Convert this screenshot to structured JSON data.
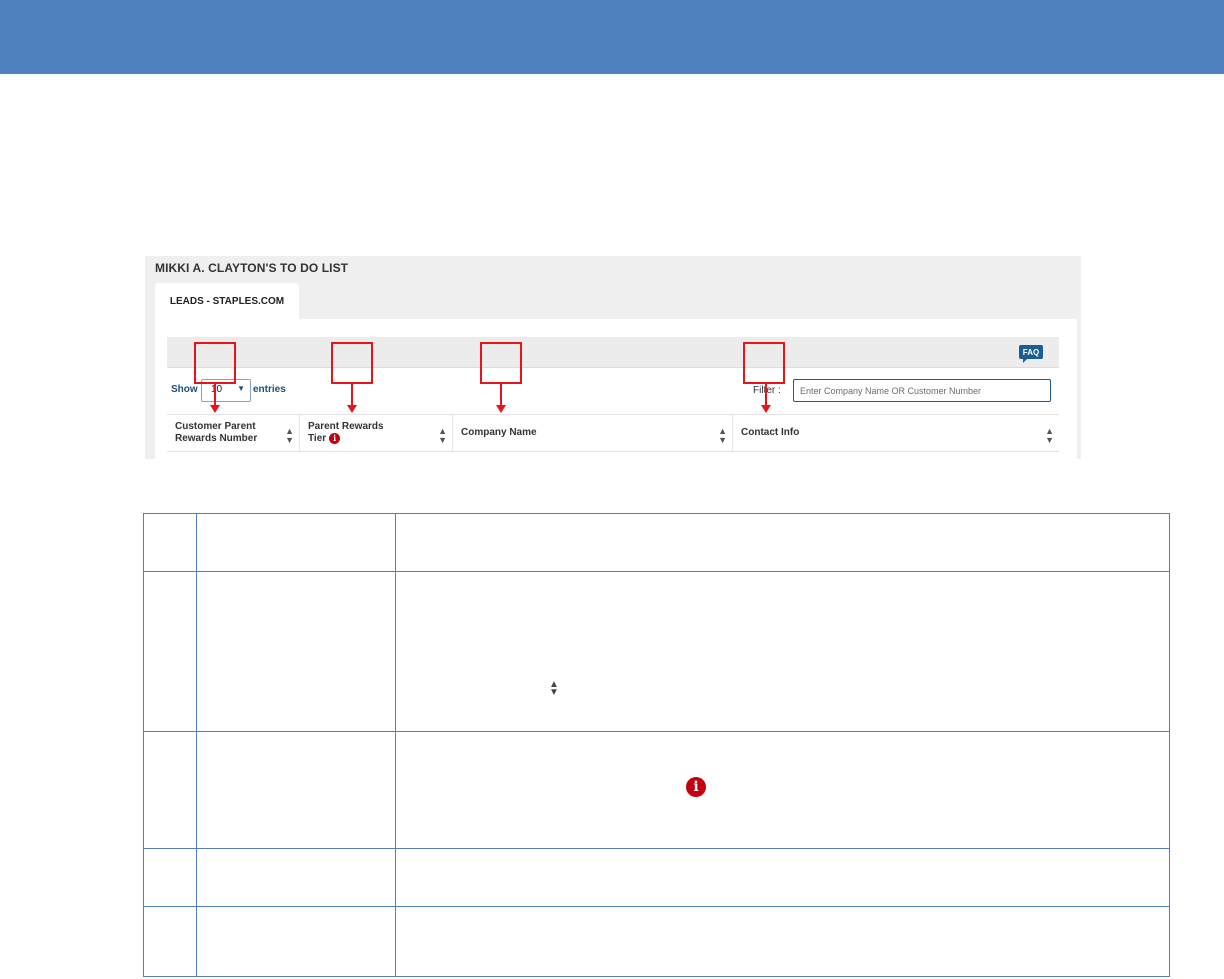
{
  "header": {
    "bar_color": "#4e81bd"
  },
  "screenshot": {
    "title": "MIKKI A. CLAYTON'S TO DO LIST",
    "tab_label": "LEADS - STAPLES.COM",
    "faq_label": "FAQ",
    "show_label": "Show",
    "entries_value": "10",
    "entries_label": "entries",
    "filter_label": "Filter :",
    "filter_placeholder": "Enter Company Name OR Customer Number",
    "columns": [
      {
        "line1": "Customer Parent",
        "line2": "Rewards Number",
        "info_icon": false
      },
      {
        "line1": "Parent Rewards",
        "line2": "Tier",
        "info_icon": true
      },
      {
        "line1": "Company Name",
        "line2": "",
        "info_icon": false
      },
      {
        "line1": "Contact Info",
        "line2": "",
        "info_icon": false
      }
    ],
    "callout_color": "#e8141b"
  },
  "description_table": {
    "border_color": "#4e81bd",
    "rows": 5
  }
}
